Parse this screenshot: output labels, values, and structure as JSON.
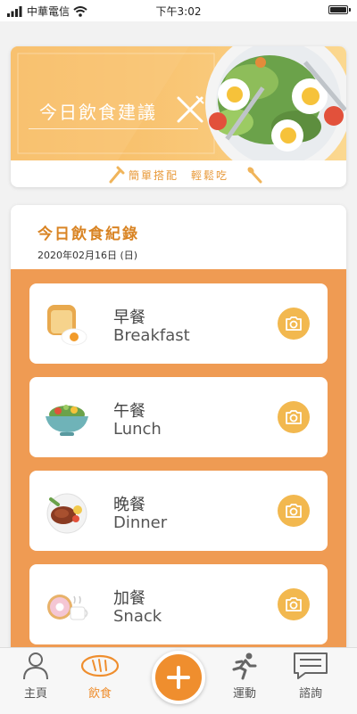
{
  "status_bar": {
    "carrier": "中華電信",
    "time": "下午3:02"
  },
  "banner": {
    "title": "今日飲食建議",
    "slogan": "簡單搭配　輕鬆吃"
  },
  "record": {
    "title": "今日飲食紀錄",
    "date": "2020年02月16日 (日)",
    "meals": [
      {
        "zh": "早餐",
        "en": "Breakfast",
        "icon": "toast-egg-icon"
      },
      {
        "zh": "午餐",
        "en": "Lunch",
        "icon": "salad-bowl-icon"
      },
      {
        "zh": "晚餐",
        "en": "Dinner",
        "icon": "steak-plate-icon"
      },
      {
        "zh": "加餐",
        "en": "Snack",
        "icon": "donut-coffee-icon"
      }
    ]
  },
  "tabbar": {
    "home": "主頁",
    "diet": "飲食",
    "exercise": "運動",
    "consult": "諮詢"
  },
  "colors": {
    "accent": "#ef8e2e",
    "panel": "#ef9b53",
    "camera": "#f2b84f"
  }
}
